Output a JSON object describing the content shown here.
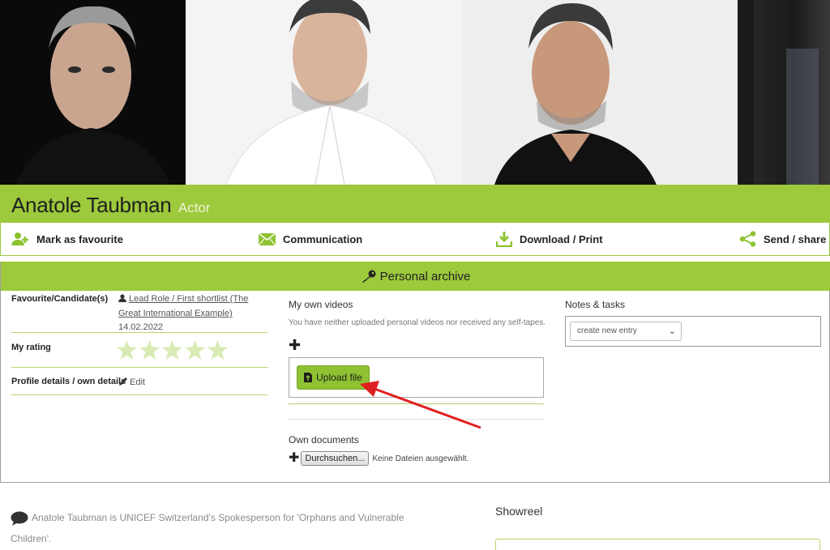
{
  "profile": {
    "name": "Anatole Taubman",
    "role": "Actor"
  },
  "actions": {
    "favourite": "Mark as favourite",
    "communication": "Communication",
    "download": "Download / Print",
    "share": "Send / share"
  },
  "archive": {
    "title": "Personal archive",
    "favourite_label": "Favourite/Candidate(s)",
    "favourite_link": "Lead Role / First shortlist (The Great International Example)",
    "favourite_date": "14.02.2022",
    "rating_label": "My rating",
    "rating_value": 0,
    "rating_max": 5,
    "details_label": "Profile details / own details",
    "edit_label": "Edit",
    "videos_title": "My own videos",
    "videos_note": "You have neither uploaded personal videos nor received any self-tapes.",
    "upload_label": "Upload file",
    "documents_title": "Own documents",
    "browse_label": "Durchsuchen...",
    "no_file_label": "Keine Dateien ausgewählt.",
    "notes_title": "Notes & tasks",
    "notes_select": "create new entry"
  },
  "bio": {
    "text": "Anatole Taubman is UNICEF Switzerland's Spokesperson for 'Orphans and Vulnerable Children'."
  },
  "showreel": {
    "title": "Showreel"
  },
  "colors": {
    "accent": "#9dc93c",
    "button": "#8ec232",
    "arrow": "#e02020"
  }
}
